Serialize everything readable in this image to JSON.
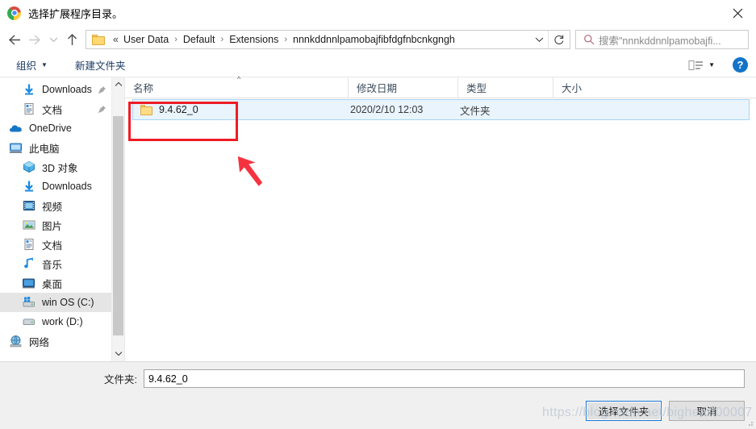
{
  "window": {
    "title": "选择扩展程序目录。",
    "app_icon": "chrome-icon",
    "close_label": "✕"
  },
  "nav": {
    "back_icon": "arrow-left-icon",
    "forward_icon": "arrow-right-icon",
    "recent_icon": "chevron-down-icon",
    "up_icon": "arrow-up-icon",
    "address": {
      "folder_icon": "folder-icon",
      "lead": "«",
      "crumbs": [
        "User Data",
        "Default",
        "Extensions",
        "nnnkddnnlpamobajfibfdgfnbcnkgngh"
      ],
      "separator": "›",
      "dropdown_icon": "chevron-down-icon",
      "refresh_icon": "refresh-icon"
    },
    "search": {
      "icon": "search-icon",
      "placeholder": "搜索\"nnnkddnnlpamobajfi..."
    }
  },
  "toolbar": {
    "organize_label": "组织",
    "organize_caret": "▼",
    "new_folder_label": "新建文件夹",
    "view_icon": "view-list-icon",
    "view_caret": "▼",
    "help_label": "?"
  },
  "sidebar": {
    "items": [
      {
        "label": "Downloads",
        "icon": "download-icon",
        "pinned": true,
        "indent": 1,
        "selected": false
      },
      {
        "label": "文档",
        "icon": "document-icon",
        "pinned": true,
        "indent": 1,
        "selected": false
      },
      {
        "label": "OneDrive",
        "icon": "onedrive-icon",
        "pinned": false,
        "indent": 0,
        "selected": false
      },
      {
        "label": "此电脑",
        "icon": "computer-icon",
        "pinned": false,
        "indent": 0,
        "selected": false
      },
      {
        "label": "3D 对象",
        "icon": "3d-objects-icon",
        "pinned": false,
        "indent": 1,
        "selected": false
      },
      {
        "label": "Downloads",
        "icon": "download-icon",
        "pinned": false,
        "indent": 1,
        "selected": false
      },
      {
        "label": "视频",
        "icon": "videos-icon",
        "pinned": false,
        "indent": 1,
        "selected": false
      },
      {
        "label": "图片",
        "icon": "pictures-icon",
        "pinned": false,
        "indent": 1,
        "selected": false
      },
      {
        "label": "文档",
        "icon": "document-icon",
        "pinned": false,
        "indent": 1,
        "selected": false
      },
      {
        "label": "音乐",
        "icon": "music-icon",
        "pinned": false,
        "indent": 1,
        "selected": false
      },
      {
        "label": "桌面",
        "icon": "desktop-icon",
        "pinned": false,
        "indent": 1,
        "selected": false
      },
      {
        "label": "win OS (C:)",
        "icon": "drive-windows-icon",
        "pinned": false,
        "indent": 1,
        "selected": true
      },
      {
        "label": "work (D:)",
        "icon": "drive-icon",
        "pinned": false,
        "indent": 1,
        "selected": false
      },
      {
        "label": "网络",
        "icon": "network-icon",
        "pinned": false,
        "indent": 0,
        "selected": false
      }
    ],
    "scroll_up_icon": "chevron-up-icon",
    "scroll_down_icon": "chevron-down-icon"
  },
  "filelist": {
    "columns": [
      {
        "key": "name",
        "label": "名称",
        "sorted": "asc"
      },
      {
        "key": "date",
        "label": "修改日期",
        "sorted": ""
      },
      {
        "key": "type",
        "label": "类型",
        "sorted": ""
      },
      {
        "key": "size",
        "label": "大小",
        "sorted": ""
      }
    ],
    "sort_caret": "^",
    "rows": [
      {
        "name": "9.4.62_0",
        "date": "2020/2/10 12:03",
        "type": "文件夹",
        "size": "",
        "icon": "folder-icon",
        "selected": true
      }
    ]
  },
  "footer": {
    "field_label": "文件夹:",
    "field_value": "9.4.62_0",
    "field_placeholder": "",
    "select_button": "选择文件夹",
    "cancel_button": "取消"
  },
  "watermark": {
    "text": "https://blog.csdn.net/bigheart00007"
  },
  "annotations": {
    "highlight_color": "#ee1c25",
    "arrow_color": "#f5333f"
  }
}
